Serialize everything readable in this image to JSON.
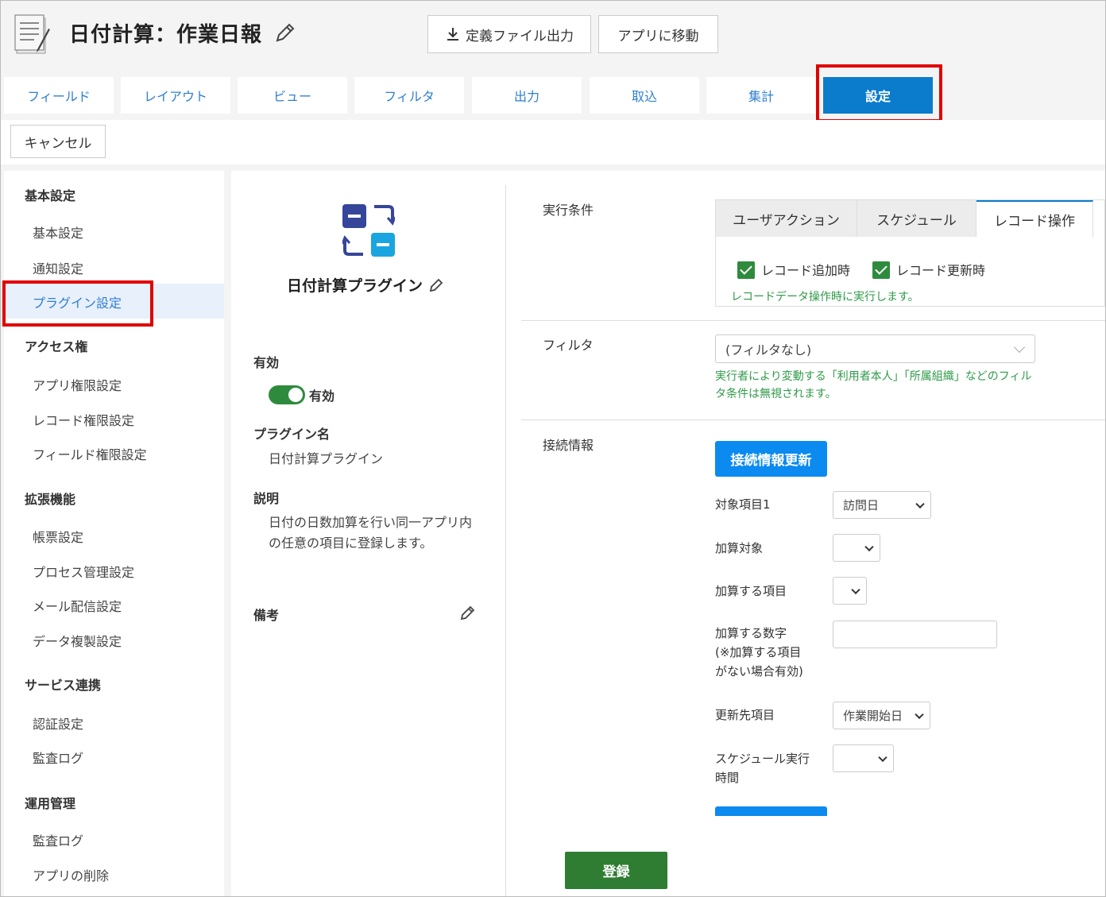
{
  "header": {
    "title": "日付計算：作業日報",
    "export_button": "定義ファイル出力",
    "goto_app_button": "アプリに移動"
  },
  "tabs": [
    {
      "label": "フィールド"
    },
    {
      "label": "レイアウト"
    },
    {
      "label": "ビュー"
    },
    {
      "label": "フィルタ"
    },
    {
      "label": "出力"
    },
    {
      "label": "取込"
    },
    {
      "label": "集計"
    },
    {
      "label": "設定",
      "active": true
    }
  ],
  "cancel_button": "キャンセル",
  "sidebar": {
    "sections": [
      {
        "heading": "基本設定",
        "items": [
          "基本設定",
          "通知設定",
          "プラグイン設定"
        ]
      },
      {
        "heading": "アクセス権",
        "items": [
          "アプリ権限設定",
          "レコード権限設定",
          "フィールド権限設定"
        ]
      },
      {
        "heading": "拡張機能",
        "items": [
          "帳票設定",
          "プロセス管理設定",
          "メール配信設定",
          "データ複製設定"
        ]
      },
      {
        "heading": "サービス連携",
        "items": [
          "認証設定",
          "監査ログ"
        ]
      },
      {
        "heading": "運用管理",
        "items": [
          "監査ログ",
          "アプリの削除"
        ]
      }
    ],
    "active_item": "プラグイン設定"
  },
  "plugin": {
    "title": "日付計算プラグイン",
    "enabled_label": "有効",
    "toggle_label": "有効",
    "name_label": "プラグイン名",
    "name_value": "日付計算プラグイン",
    "desc_label": "説明",
    "desc_line1": "日付の日数加算を行い同一アプリ内",
    "desc_line2": "の任意の項目に登録します。",
    "memo_label": "備考"
  },
  "settings": {
    "exec_condition_label": "実行条件",
    "cond_tabs": [
      "ユーザアクション",
      "スケジュール",
      "レコード操作"
    ],
    "active_cond_tab": "レコード操作",
    "checkbox_add": "レコード追加時",
    "checkbox_update": "レコード更新時",
    "cond_note": "レコードデータ操作時に実行します。",
    "filter_label": "フィルタ",
    "filter_value": "(フィルタなし)",
    "filter_note_line1": "実行者により変動する「利用者本人」「所属組織」などのフィル",
    "filter_note_line2": "タ条件は無視されます。",
    "connection_label": "接続情報",
    "connection_update_button": "接続情報更新",
    "fields": [
      {
        "label": "対象項目1",
        "value": "訪問日"
      },
      {
        "label": "加算対象",
        "value": ""
      },
      {
        "label": "加算する項目",
        "value": ""
      },
      {
        "label_lines": [
          "加算する数字",
          "(※加算する項目",
          "がない場合有効)"
        ],
        "value": ""
      },
      {
        "label": "更新先項目",
        "value": "作業開始日"
      },
      {
        "label_lines": [
          "スケジュール実行",
          "時間"
        ],
        "value": ""
      }
    ],
    "register_button": "登録"
  },
  "colors": {
    "accent_blue": "#0b7ccc",
    "link_blue": "#2f7fd0",
    "green": "#2e7d32",
    "highlight_red": "#e00000"
  }
}
